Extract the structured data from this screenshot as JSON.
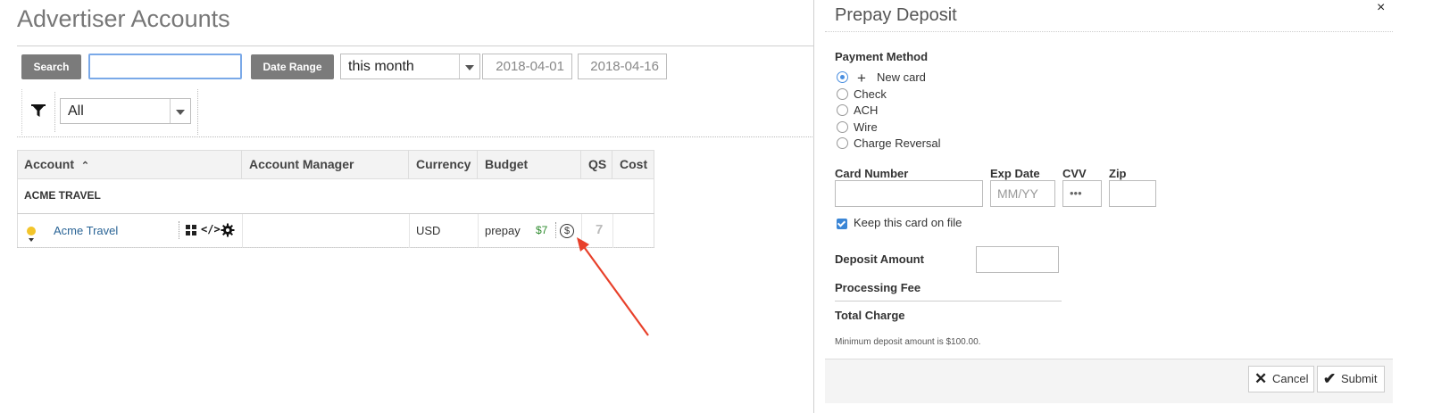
{
  "page": {
    "title": "Advertiser Accounts"
  },
  "toolbar": {
    "search_label": "Search",
    "search_value": "",
    "date_range_label": "Date Range",
    "range_value": "this month",
    "date_start": "2018-04-01",
    "date_end": "2018-04-16",
    "filter_value": "All"
  },
  "table": {
    "columns": [
      "Account",
      "Account Manager",
      "Currency",
      "Budget",
      "QS",
      "Cost"
    ],
    "group_label": "ACME TRAVEL",
    "rows": [
      {
        "account": "Acme Travel",
        "account_manager": "",
        "currency": "USD",
        "budget_type": "prepay",
        "budget_value": "$7",
        "qs": "7",
        "cost": ""
      }
    ]
  },
  "drawer": {
    "title": "Prepay Deposit",
    "close_glyph": "×",
    "payment_method_label": "Payment Method",
    "payment_methods": [
      "New card",
      "Check",
      "ACH",
      "Wire",
      "Charge Reversal"
    ],
    "selected_method": "New card",
    "card_number_label": "Card Number",
    "exp_date_label": "Exp Date",
    "exp_placeholder": "MM/YY",
    "cvv_label": "CVV",
    "cvv_placeholder": "•••",
    "zip_label": "Zip",
    "keep_card_label": "Keep this card on file",
    "keep_card_checked": true,
    "deposit_amount_label": "Deposit Amount",
    "processing_fee_label": "Processing Fee",
    "total_charge_label": "Total Charge",
    "hint": "Minimum deposit amount is $100.00.",
    "cancel_label": "Cancel",
    "submit_label": "Submit"
  },
  "colors": {
    "accent": "#4a8fe0",
    "link": "#2a6496",
    "budget_green": "#2e8b2e",
    "arrow": "#e8402a",
    "status_bulb": "#f3c52b"
  },
  "icons": [
    "filter-icon",
    "grid-icon",
    "code-icon",
    "gear-icon",
    "dollar-icon",
    "plus-icon",
    "close-icon",
    "check-icon"
  ]
}
